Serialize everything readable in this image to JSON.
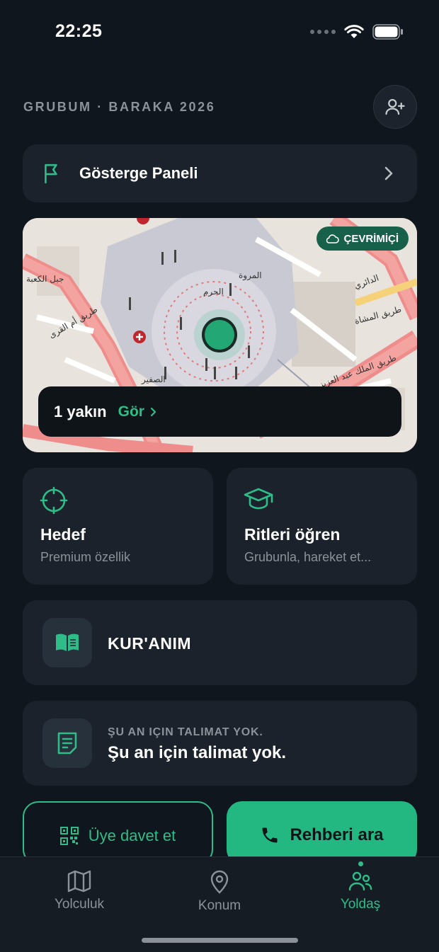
{
  "status_bar": {
    "time": "22:25"
  },
  "header": {
    "group_title": "GRUBUM · BARAKA 2026"
  },
  "dashboard": {
    "label": "Gösterge Paneli"
  },
  "map": {
    "online_badge": "ÇEVRİMİÇİ",
    "labels": [
      "المروة",
      "الحرم",
      "الصفير",
      "طريق أم القرى",
      "طريق المشاة",
      "طريق الملك عبد العزيز",
      "جبل الكعبة",
      "الدائري"
    ],
    "nearby_count": "1 yakın",
    "nearby_link": "Gör"
  },
  "tiles": [
    {
      "title": "Hedef",
      "subtitle": "Premium özellik",
      "icon": "crosshair-icon"
    },
    {
      "title": "Ritleri öğren",
      "subtitle": "Grubunla, hareket et...",
      "icon": "graduation-cap-icon"
    }
  ],
  "quran": {
    "label": "KUR'ANIM",
    "icon": "book-open-icon"
  },
  "instructions": {
    "label": "ŞU AN IÇIN TALIMAT YOK.",
    "text": "Şu an için talimat yok.",
    "icon": "note-icon"
  },
  "actions": {
    "invite_label": "Üye davet et",
    "call_label": "Rehberi ara"
  },
  "tabs": [
    {
      "label": "Yolculuk",
      "icon": "map-icon"
    },
    {
      "label": "Konum",
      "icon": "location-pin-icon"
    },
    {
      "label": "Yoldaş",
      "icon": "users-icon"
    }
  ],
  "colors": {
    "accent": "#2ebd88",
    "background": "#10161d",
    "card": "#1b222b",
    "badge": "#17604a"
  }
}
